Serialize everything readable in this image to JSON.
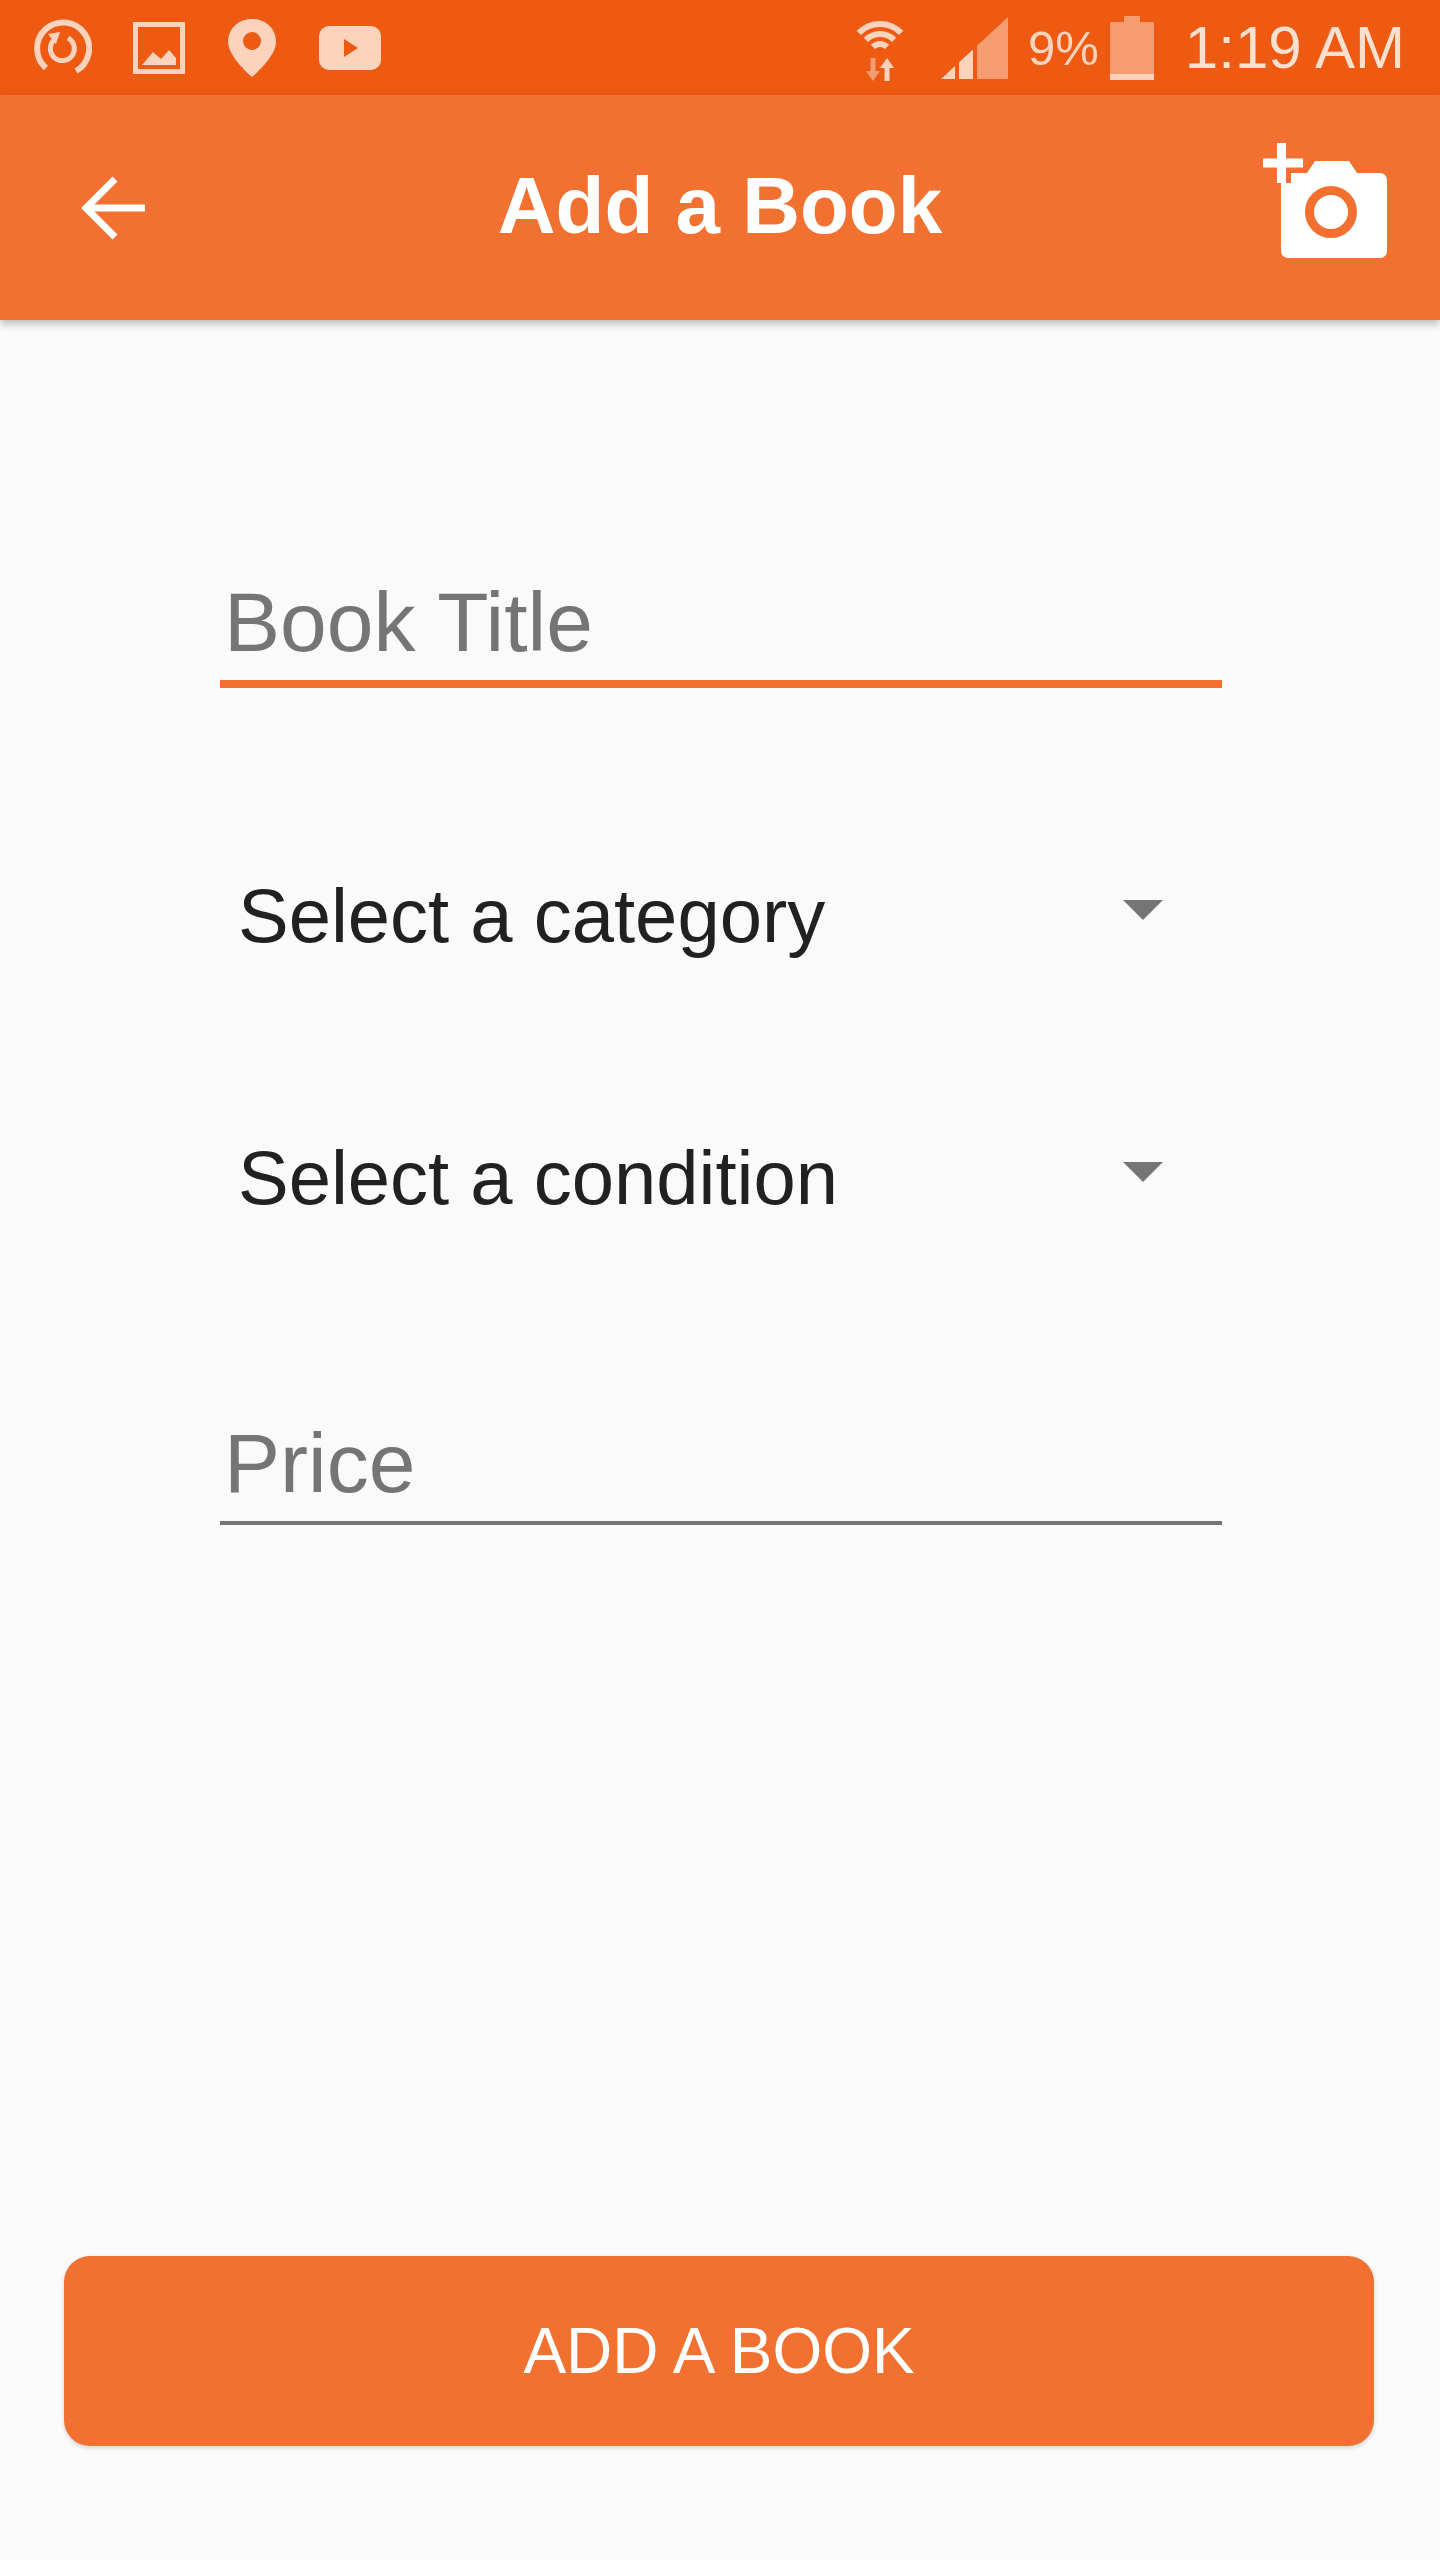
{
  "status_bar": {
    "battery": "9%",
    "time": "1:19 AM"
  },
  "app_bar": {
    "title": "Add a Book"
  },
  "form": {
    "fields": [
      {
        "kind": "text",
        "placeholder": "Book Title",
        "focused": true
      },
      {
        "kind": "dropdown",
        "value": "Select a category"
      },
      {
        "kind": "dropdown",
        "value": "Select a condition"
      },
      {
        "kind": "text",
        "placeholder": "Price",
        "focused": false
      }
    ]
  },
  "submit_button": {
    "label": "ADD A BOOK"
  }
}
